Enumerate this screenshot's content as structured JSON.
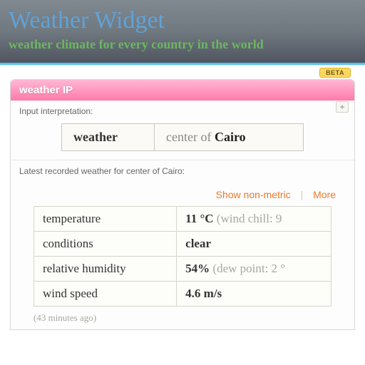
{
  "header": {
    "title": "Weather Widget",
    "subtitle": "weather climate for every country in the world"
  },
  "beta_label": "BETA",
  "widget": {
    "title": "weather IP",
    "plus": "+",
    "interp_label": "Input interpretation:",
    "interp_left": "weather",
    "interp_right_prefix": "center of ",
    "interp_right_strong": "Cairo",
    "results_label": "Latest recorded weather for center of Cairo:",
    "actions": {
      "nonmetric": "Show non-metric",
      "more": "More"
    },
    "rows": [
      {
        "label": "temperature",
        "value": "11 °C",
        "extra": " (wind chill: 9"
      },
      {
        "label": "conditions",
        "value": "clear",
        "extra": ""
      },
      {
        "label": "relative humidity",
        "value": "54%",
        "extra": " (dew point: 2 °"
      },
      {
        "label": "wind speed",
        "value": "4.6 m/s",
        "extra": ""
      }
    ],
    "timestamp": "(43 minutes ago)"
  }
}
